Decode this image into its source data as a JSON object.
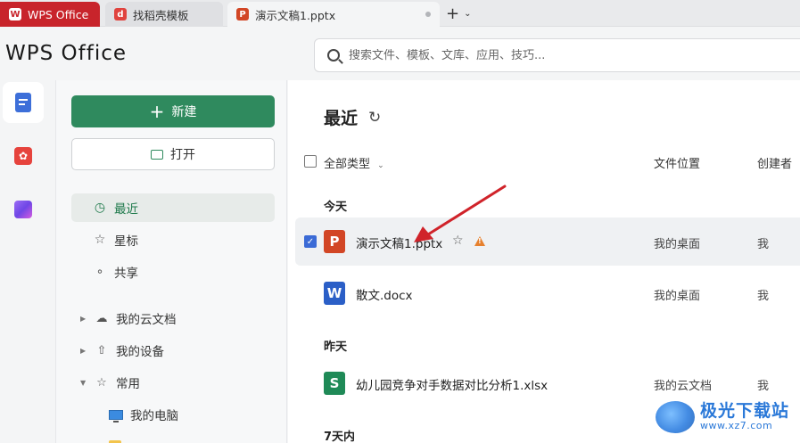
{
  "tabs": [
    {
      "label": "WPS Office",
      "icon": "wps-logo-icon"
    },
    {
      "label": "找稻壳模板",
      "icon": "docer-icon"
    },
    {
      "label": "演示文稿1.pptx",
      "icon": "ppt-icon",
      "icon_letter": "P"
    }
  ],
  "new_tab_label": "+",
  "app_title": "WPS Office",
  "search": {
    "placeholder": "搜索文件、模板、文库、应用、技巧..."
  },
  "sidebar": {
    "new_label": "新建",
    "open_label": "打开",
    "nav": [
      {
        "label": "最近",
        "icon": "clock-icon",
        "active": true
      },
      {
        "label": "星标",
        "icon": "star-icon"
      },
      {
        "label": "共享",
        "icon": "share-icon"
      }
    ],
    "tree": [
      {
        "label": "我的云文档",
        "icon": "cloud-icon"
      },
      {
        "label": "我的设备",
        "icon": "device-icon"
      },
      {
        "label": "常用",
        "icon": "pin-icon"
      },
      {
        "label": "我的电脑",
        "icon": "computer-icon"
      }
    ]
  },
  "main": {
    "title": "最近",
    "column_type": "全部类型",
    "column_location": "文件位置",
    "column_creator": "创建者",
    "groups": [
      {
        "label": "今天"
      },
      {
        "label": "昨天"
      },
      {
        "label": "7天内"
      }
    ],
    "files": [
      {
        "name": "演示文稿1.pptx",
        "type": "ppt",
        "letter": "P",
        "location": "我的桌面",
        "creator": "我",
        "selected": true,
        "warning": "!"
      },
      {
        "name": "散文.docx",
        "type": "doc",
        "letter": "W",
        "location": "我的桌面",
        "creator": "我",
        "selected": false
      },
      {
        "name": "幼儿园竞争对手数据对比分析1.xlsx",
        "type": "xls",
        "letter": "S",
        "location": "我的云文档",
        "creator": "我",
        "selected": false
      }
    ]
  },
  "watermark": {
    "title": "极光下载站",
    "url": "www.xz7.com"
  },
  "colors": {
    "accent_green": "#2f8a5e",
    "wps_red": "#c8242b",
    "arrow_red": "#d0232a"
  }
}
